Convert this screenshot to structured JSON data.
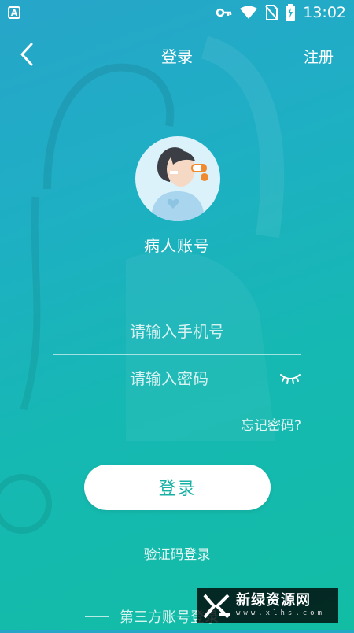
{
  "status_bar": {
    "app_badge": "A",
    "icons": [
      "key-icon",
      "wifi-icon",
      "no-sim-icon",
      "battery-charging-icon"
    ],
    "time": "13:02"
  },
  "nav": {
    "back_icon": "chevron-left-icon",
    "title": "登录",
    "register_label": "注册"
  },
  "profile": {
    "avatar_icon": "patient-avatar-icon",
    "account_type": "病人账号"
  },
  "form": {
    "phone_placeholder": "请输入手机号",
    "phone_value": "",
    "password_placeholder": "请输入密码",
    "password_value": "",
    "password_toggle_icon": "eye-closed-icon",
    "forgot_label": "忘记密码?"
  },
  "actions": {
    "login_label": "登录",
    "sms_login_label": "验证码登录",
    "third_party_label": "第三方账号登录"
  },
  "watermark": {
    "main": "新绿资源网",
    "sub": "www.xlhs.com"
  },
  "colors": {
    "gradient_top": "#27a5c9",
    "gradient_bottom": "#12bda4",
    "button_text": "#17b2a5"
  }
}
